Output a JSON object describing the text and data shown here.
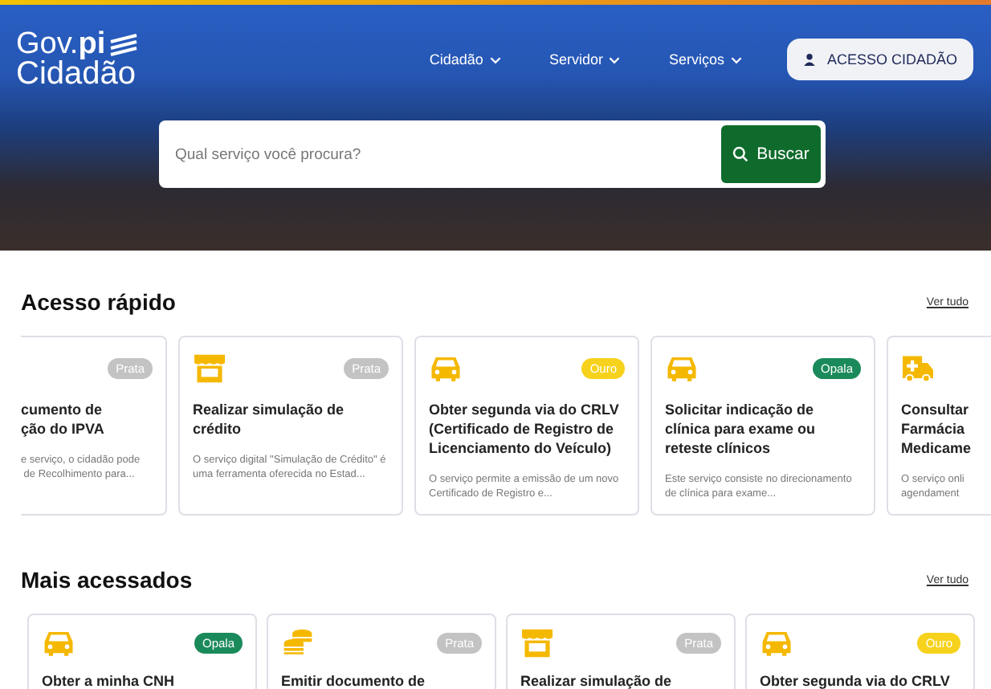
{
  "header": {
    "logo_top": "Gov.",
    "logo_accent": "pi",
    "logo_bottom": "Cidadão",
    "nav": [
      {
        "label": "Cidadão"
      },
      {
        "label": "Servidor"
      },
      {
        "label": "Serviços"
      }
    ],
    "login_button": "ACESSO CIDADÃO"
  },
  "search": {
    "placeholder": "Qual serviço você procura?",
    "button": "Buscar"
  },
  "sections": [
    {
      "title": "Acesso rápido",
      "link": "Ver tudo",
      "cards": [
        {
          "kind": "blank",
          "badge": "Prata",
          "color": "#c3c3c3",
          "title": "cumento de\nção do IPVA",
          "description": "e serviço, o cidadão pode\n de Recolhimento para..."
        },
        {
          "kind": "store",
          "badge": "Prata",
          "color": "#c3c3c3",
          "title": "Realizar simulação de crédito",
          "description": "O serviço digital \"Simulação de Crédito\" é uma ferramenta oferecida no Estad..."
        },
        {
          "kind": "car",
          "badge": "Ouro",
          "color": "#f7d21c",
          "title": "Obter segunda via do CRLV (Certificado de Registro de Licenciamento do Veículo)",
          "description": "O serviço permite a emissão de um novo Certificado de Registro e..."
        },
        {
          "kind": "car",
          "badge": "Opala",
          "color": "#1b8a5a",
          "title": "Solicitar indicação de clínica para exame ou reteste clínicos",
          "description": "Este serviço consiste no direcionamento de clínica para exame..."
        },
        {
          "kind": "ambulance",
          "title": "Consultar\nFarmácia\nMedicame",
          "description": "O serviço onli\nagendament"
        }
      ]
    },
    {
      "title": "Mais acessados",
      "link": "Ver tudo",
      "cards": [
        {
          "kind": "car",
          "badge": "Opala",
          "color": "#1b8a5a",
          "title": "Obter a minha CNH"
        },
        {
          "kind": "coins",
          "badge": "Prata",
          "color": "#c3c3c3",
          "title": "Emitir documento de"
        },
        {
          "kind": "store",
          "badge": "Prata",
          "color": "#c3c3c3",
          "title": "Realizar simulação de"
        },
        {
          "kind": "car",
          "badge": "Ouro",
          "color": "#f7d21c",
          "title": "Obter segunda via do CRLV"
        }
      ]
    }
  ]
}
